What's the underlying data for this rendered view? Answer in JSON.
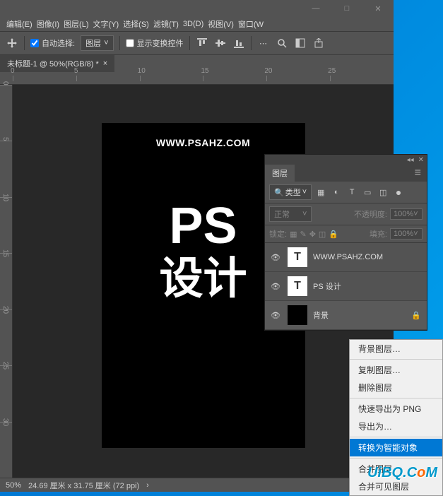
{
  "menu": {
    "edit": "编辑(E)",
    "image": "图像(I)",
    "layer": "图层(L)",
    "text": "文字(Y)",
    "select": "选择(S)",
    "filter": "滤镜(T)",
    "three_d": "3D(D)",
    "view": "视图(V)",
    "window": "窗口(W"
  },
  "toolbar": {
    "auto_select": "自动选择:",
    "layer": "图层",
    "show_transform": "显示变换控件"
  },
  "doc": {
    "title": "未标题-1 @ 50%(RGB/8) *"
  },
  "ruler_h": [
    "0",
    "5",
    "10",
    "15",
    "20",
    "25"
  ],
  "ruler_v": [
    "0",
    "5",
    "10",
    "15",
    "20",
    "25",
    "30"
  ],
  "canvas": {
    "url": "WWW.PSAHZ.COM",
    "ps": "PS",
    "design": "设计"
  },
  "status": {
    "zoom": "50%",
    "dims": "24.69 厘米 x 31.75 厘米 (72 ppi)"
  },
  "layers": {
    "tab": "图层",
    "search": "类型",
    "blend": "正常",
    "opacity_label": "不透明度:",
    "opacity": "100%",
    "lock": "锁定:",
    "fill_label": "填充:",
    "fill": "100%",
    "items": [
      {
        "name": "WWW.PSAHZ.COM",
        "type": "T"
      },
      {
        "name": "PS 设计",
        "type": "T"
      },
      {
        "name": "背景",
        "type": "bg"
      }
    ]
  },
  "context": {
    "items": [
      "背景图层…",
      "复制图层…",
      "删除图层",
      "快速导出为 PNG",
      "导出为…",
      "转换为智能对象",
      "合并图层",
      "合并可见图层"
    ],
    "highlighted": "转换为智能对象"
  },
  "watermark": {
    "pre": "U",
    "mid": "i",
    "b": "B",
    "q": "Q.C",
    "o": "o",
    "m": "M"
  }
}
